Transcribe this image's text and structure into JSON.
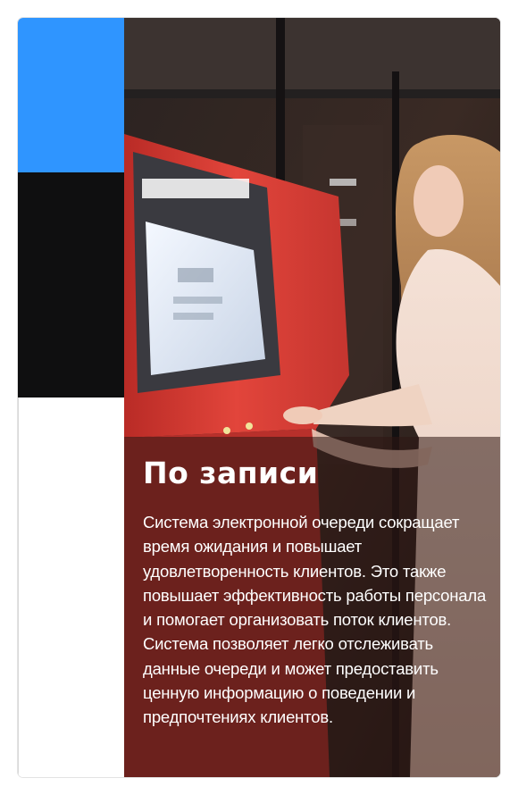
{
  "card": {
    "title": "По записи",
    "description": "Система электронной очереди сокращает время ожидания и повышает удовлетворенность клиентов. Это также повышает эффективность работы персонала и помогает организовать поток клиентов. Система позволяет легко отслеживать данные очереди и может предоставить ценную информацию о поведении и предпочтениях клиентов."
  },
  "colors": {
    "accent_blue": "#2f95ff",
    "strip_black": "#0f0f10",
    "kiosk_red": "#e2453b"
  }
}
